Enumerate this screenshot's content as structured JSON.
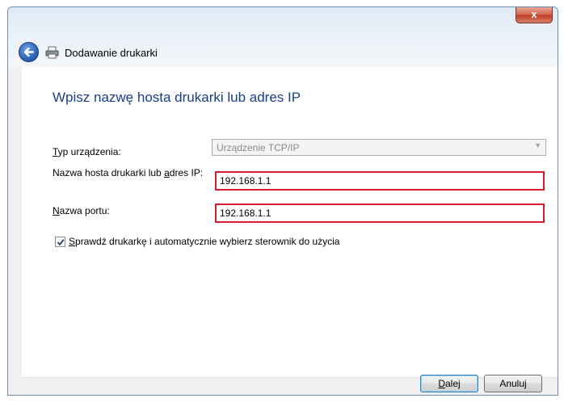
{
  "window": {
    "title": "Dodawanie drukarki",
    "close_glyph": "x"
  },
  "page": {
    "heading": "Wpisz nazwę hosta drukarki lub adres IP"
  },
  "form": {
    "device_type": {
      "label_access": "T",
      "label_rest": "yp urządzenia:",
      "value": "Urządzenie TCP/IP"
    },
    "host": {
      "label_before": "Nazwa hosta drukarki lub ",
      "label_access": "a",
      "label_after": "dres IP:",
      "value": "192.168.1.1"
    },
    "port": {
      "label_access": "N",
      "label_rest": "azwa portu:",
      "value": "192.168.1.1"
    },
    "auto_driver": {
      "checked": true,
      "label_access": "S",
      "label_rest": "prawdź drukarkę i automatycznie wybierz sterownik do użycia"
    }
  },
  "buttons": {
    "next_access": "D",
    "next_rest": "alej",
    "cancel": "Anuluj"
  },
  "icons": {
    "back": "back-arrow-icon",
    "printer": "printer-icon",
    "dropdown": "chevron-down-icon",
    "check": "checkmark-icon"
  },
  "colors": {
    "heading": "#1a3e8c",
    "highlight_border": "#d81e2c",
    "close_button": "#c23a22"
  }
}
